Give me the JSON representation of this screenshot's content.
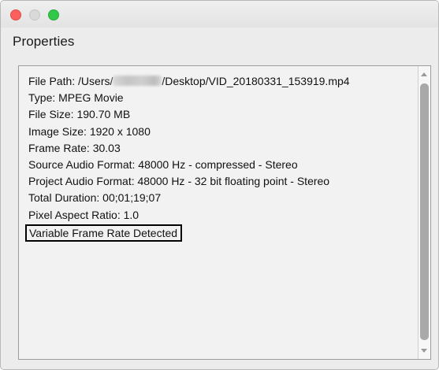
{
  "window": {
    "title": "Properties"
  },
  "properties": {
    "file_path_prefix": "File Path: /Users/",
    "file_path_suffix": "/Desktop/VID_20180331_153919.mp4",
    "type": "Type: MPEG Movie",
    "file_size": "File Size: 190.70 MB",
    "image_size": "Image Size: 1920 x 1080",
    "frame_rate": "Frame Rate: 30.03",
    "source_audio": "Source Audio Format: 48000 Hz - compressed - Stereo",
    "project_audio": "Project Audio Format: 48000 Hz - 32 bit floating point - Stereo",
    "total_duration": "Total Duration: 00;01;19;07",
    "pixel_aspect": "Pixel Aspect Ratio: 1.0",
    "variable_frame_rate": "Variable Frame Rate Detected"
  },
  "colors": {
    "close": "#fc605c",
    "minimize": "#d9d9d9",
    "zoom": "#34c84a"
  }
}
